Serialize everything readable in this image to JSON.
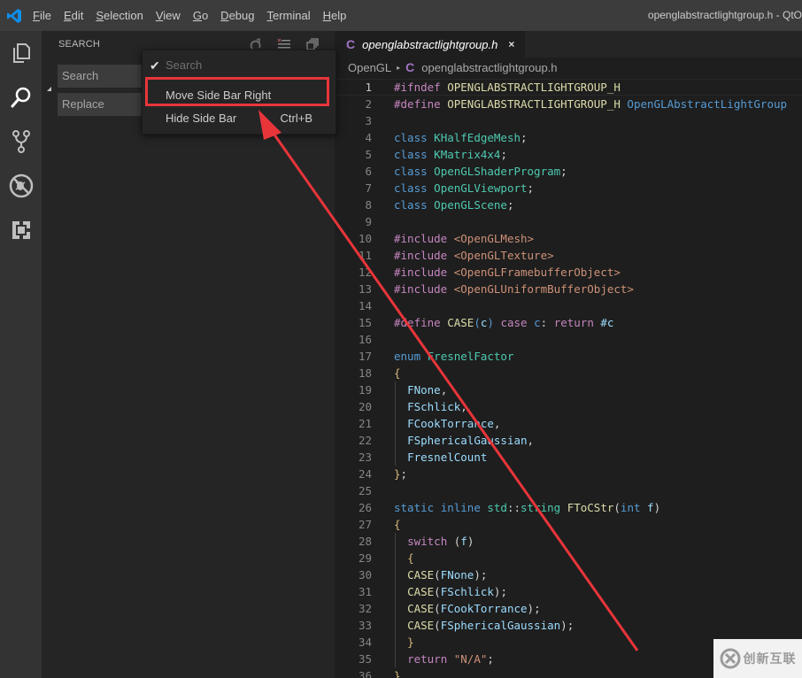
{
  "titlebar": {
    "menu": [
      {
        "label": "File",
        "mnemonic": "F",
        "rest": "ile"
      },
      {
        "label": "Edit",
        "mnemonic": "E",
        "rest": "dit"
      },
      {
        "label": "Selection",
        "mnemonic": "S",
        "rest": "election"
      },
      {
        "label": "View",
        "mnemonic": "V",
        "rest": "iew"
      },
      {
        "label": "Go",
        "mnemonic": "G",
        "rest": "o"
      },
      {
        "label": "Debug",
        "mnemonic": "D",
        "rest": "ebug"
      },
      {
        "label": "Terminal",
        "mnemonic": "T",
        "rest": "erminal"
      },
      {
        "label": "Help",
        "mnemonic": "H",
        "rest": "elp"
      }
    ],
    "window_title": "openglabstractlightgroup.h - QtO"
  },
  "activitybar": {
    "items": [
      {
        "name": "explorer",
        "icon": "files-icon",
        "active": false
      },
      {
        "name": "search",
        "icon": "search-icon",
        "active": true
      },
      {
        "name": "source-control",
        "icon": "source-control-icon",
        "active": false
      },
      {
        "name": "debug",
        "icon": "debug-icon",
        "active": false
      },
      {
        "name": "extensions",
        "icon": "extensions-icon",
        "active": false
      }
    ]
  },
  "sidebar": {
    "title": "SEARCH",
    "search_placeholder": "Search",
    "replace_placeholder": "Replace",
    "actions": [
      "refresh-icon",
      "clear-results-icon",
      "collapse-all-icon"
    ]
  },
  "context_menu": {
    "items": [
      {
        "label": "Search",
        "checked": true,
        "disabled": true,
        "shortcut": ""
      },
      {
        "label": "Move Side Bar Right",
        "checked": false,
        "disabled": false,
        "shortcut": "",
        "highlighted": true
      },
      {
        "label": "Hide Side Bar",
        "checked": false,
        "disabled": false,
        "shortcut": "Ctrl+B"
      }
    ]
  },
  "editor": {
    "tab": {
      "icon": "C",
      "label": "openglabstractlightgroup.h",
      "close": "×"
    },
    "breadcrumb": {
      "folder": "OpenGL",
      "icon": "C",
      "file": "openglabstractlightgroup.h"
    },
    "current_line": 1,
    "lines": [
      {
        "n": "1",
        "tokens": [
          [
            "pp",
            "#ifndef"
          ],
          [
            "pl",
            " "
          ],
          [
            "mac",
            "OPENGLABSTRACTLIGHTGROUP_H"
          ]
        ]
      },
      {
        "n": "2",
        "tokens": [
          [
            "pp",
            "#define"
          ],
          [
            "pl",
            " "
          ],
          [
            "mac",
            "OPENGLABSTRACTLIGHTGROUP_H"
          ],
          [
            "pl",
            " "
          ],
          [
            "kw",
            "OpenGLAbstractLightGroup"
          ]
        ]
      },
      {
        "n": "3",
        "tokens": []
      },
      {
        "n": "4",
        "tokens": [
          [
            "kw",
            "class"
          ],
          [
            "pl",
            " "
          ],
          [
            "ty",
            "KHalfEdgeMesh"
          ],
          [
            "pl",
            ";"
          ]
        ]
      },
      {
        "n": "5",
        "tokens": [
          [
            "kw",
            "class"
          ],
          [
            "pl",
            " "
          ],
          [
            "ty",
            "KMatrix4x4"
          ],
          [
            "pl",
            ";"
          ]
        ]
      },
      {
        "n": "6",
        "tokens": [
          [
            "kw",
            "class"
          ],
          [
            "pl",
            " "
          ],
          [
            "ty",
            "OpenGLShaderProgram"
          ],
          [
            "pl",
            ";"
          ]
        ]
      },
      {
        "n": "7",
        "tokens": [
          [
            "kw",
            "class"
          ],
          [
            "pl",
            " "
          ],
          [
            "ty",
            "OpenGLViewport"
          ],
          [
            "pl",
            ";"
          ]
        ]
      },
      {
        "n": "8",
        "tokens": [
          [
            "kw",
            "class"
          ],
          [
            "pl",
            " "
          ],
          [
            "ty",
            "OpenGLScene"
          ],
          [
            "pl",
            ";"
          ]
        ]
      },
      {
        "n": "9",
        "tokens": []
      },
      {
        "n": "10",
        "tokens": [
          [
            "pp",
            "#include"
          ],
          [
            "pl",
            " "
          ],
          [
            "str",
            "<OpenGLMesh>"
          ]
        ]
      },
      {
        "n": "11",
        "tokens": [
          [
            "pp",
            "#include"
          ],
          [
            "pl",
            " "
          ],
          [
            "str",
            "<OpenGLTexture>"
          ]
        ]
      },
      {
        "n": "12",
        "tokens": [
          [
            "pp",
            "#include"
          ],
          [
            "pl",
            " "
          ],
          [
            "str",
            "<OpenGLFramebufferObject>"
          ]
        ]
      },
      {
        "n": "13",
        "tokens": [
          [
            "pp",
            "#include"
          ],
          [
            "pl",
            " "
          ],
          [
            "str",
            "<OpenGLUniformBufferObject>"
          ]
        ]
      },
      {
        "n": "14",
        "tokens": []
      },
      {
        "n": "15",
        "tokens": [
          [
            "pp",
            "#define"
          ],
          [
            "pl",
            " "
          ],
          [
            "mac",
            "CASE"
          ],
          [
            "kw",
            "("
          ],
          [
            "var",
            "c"
          ],
          [
            "kw",
            ")"
          ],
          [
            "pl",
            " "
          ],
          [
            "ctl",
            "case"
          ],
          [
            "pl",
            " "
          ],
          [
            "kw",
            "c"
          ],
          [
            "pl",
            ": "
          ],
          [
            "ctl",
            "return"
          ],
          [
            "pl",
            " "
          ],
          [
            "var",
            "#c"
          ]
        ]
      },
      {
        "n": "16",
        "tokens": []
      },
      {
        "n": "17",
        "tokens": [
          [
            "kw",
            "enum"
          ],
          [
            "pl",
            " "
          ],
          [
            "ty",
            "FresnelFactor"
          ]
        ]
      },
      {
        "n": "18",
        "tokens": [
          [
            "br",
            "{"
          ]
        ]
      },
      {
        "n": "19",
        "indent": true,
        "tokens": [
          [
            "pl",
            "  "
          ],
          [
            "var",
            "FNone"
          ],
          [
            "pl",
            ","
          ]
        ]
      },
      {
        "n": "20",
        "indent": true,
        "tokens": [
          [
            "pl",
            "  "
          ],
          [
            "var",
            "FSchlick"
          ],
          [
            "pl",
            ","
          ]
        ]
      },
      {
        "n": "21",
        "indent": true,
        "tokens": [
          [
            "pl",
            "  "
          ],
          [
            "var",
            "FCookTorrance"
          ],
          [
            "pl",
            ","
          ]
        ]
      },
      {
        "n": "22",
        "indent": true,
        "tokens": [
          [
            "pl",
            "  "
          ],
          [
            "var",
            "FSphericalGaussian"
          ],
          [
            "pl",
            ","
          ]
        ]
      },
      {
        "n": "23",
        "indent": true,
        "tokens": [
          [
            "pl",
            "  "
          ],
          [
            "var",
            "FresnelCount"
          ]
        ]
      },
      {
        "n": "24",
        "tokens": [
          [
            "br",
            "}"
          ],
          [
            "pl",
            ";"
          ]
        ]
      },
      {
        "n": "25",
        "tokens": []
      },
      {
        "n": "26",
        "tokens": [
          [
            "kw",
            "static"
          ],
          [
            "pl",
            " "
          ],
          [
            "kw",
            "inline"
          ],
          [
            "pl",
            " "
          ],
          [
            "ty",
            "std"
          ],
          [
            "pl",
            "::"
          ],
          [
            "ty",
            "string"
          ],
          [
            "pl",
            " "
          ],
          [
            "mac",
            "FToCStr"
          ],
          [
            "pl",
            "("
          ],
          [
            "kw",
            "int"
          ],
          [
            "pl",
            " "
          ],
          [
            "var",
            "f"
          ],
          [
            "pl",
            ")"
          ]
        ]
      },
      {
        "n": "27",
        "tokens": [
          [
            "br",
            "{"
          ]
        ]
      },
      {
        "n": "28",
        "indent": true,
        "tokens": [
          [
            "pl",
            "  "
          ],
          [
            "ctl",
            "switch"
          ],
          [
            "pl",
            " ("
          ],
          [
            "var",
            "f"
          ],
          [
            "pl",
            ")"
          ]
        ]
      },
      {
        "n": "29",
        "indent": true,
        "tokens": [
          [
            "pl",
            "  "
          ],
          [
            "br",
            "{"
          ]
        ]
      },
      {
        "n": "30",
        "indent": true,
        "tokens": [
          [
            "pl",
            "  "
          ],
          [
            "mac",
            "CASE"
          ],
          [
            "pl",
            "("
          ],
          [
            "var",
            "FNone"
          ],
          [
            "pl",
            ");"
          ]
        ]
      },
      {
        "n": "31",
        "indent": true,
        "tokens": [
          [
            "pl",
            "  "
          ],
          [
            "mac",
            "CASE"
          ],
          [
            "pl",
            "("
          ],
          [
            "var",
            "FSchlick"
          ],
          [
            "pl",
            ");"
          ]
        ]
      },
      {
        "n": "32",
        "indent": true,
        "tokens": [
          [
            "pl",
            "  "
          ],
          [
            "mac",
            "CASE"
          ],
          [
            "pl",
            "("
          ],
          [
            "var",
            "FCookTorrance"
          ],
          [
            "pl",
            ");"
          ]
        ]
      },
      {
        "n": "33",
        "indent": true,
        "tokens": [
          [
            "pl",
            "  "
          ],
          [
            "mac",
            "CASE"
          ],
          [
            "pl",
            "("
          ],
          [
            "var",
            "FSphericalGaussian"
          ],
          [
            "pl",
            ");"
          ]
        ]
      },
      {
        "n": "34",
        "indent": true,
        "tokens": [
          [
            "pl",
            "  "
          ],
          [
            "br",
            "}"
          ]
        ]
      },
      {
        "n": "35",
        "indent": true,
        "tokens": [
          [
            "pl",
            "  "
          ],
          [
            "ctl",
            "return"
          ],
          [
            "pl",
            " "
          ],
          [
            "str",
            "\"N/A\""
          ],
          [
            "pl",
            ";"
          ]
        ]
      },
      {
        "n": "36",
        "tokens": [
          [
            "br",
            "}"
          ]
        ]
      }
    ]
  },
  "annotation": {
    "color": "#e8353a",
    "type": "arrow",
    "points_to": "Move Side Bar Right"
  },
  "watermark": {
    "text": "创新互联"
  },
  "colors": {
    "titlebar": "#3c3c3c",
    "activitybar": "#333333",
    "sidebar": "#252526",
    "editor": "#1e1e1e",
    "accent_logo": "#0e8ee9",
    "highlight_box": "#e8353a"
  }
}
